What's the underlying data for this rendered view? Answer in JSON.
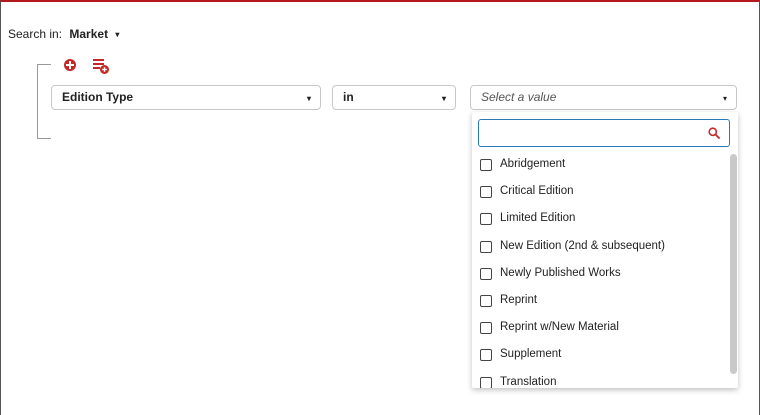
{
  "search_in": {
    "label": "Search in:",
    "scope": "Market",
    "caret": "▾"
  },
  "query_row": {
    "field": {
      "value": "Edition Type",
      "caret": "▾"
    },
    "operator": {
      "value": "in",
      "caret": "▾"
    },
    "value_select": {
      "placeholder": "Select a value",
      "caret": "▾"
    }
  },
  "toolbar_icons": [
    "add-condition-icon",
    "add-group-icon"
  ],
  "dropdown": {
    "search": {
      "value": "",
      "icon": "search-icon"
    },
    "options": [
      {
        "label": "Abridgement",
        "checked": false
      },
      {
        "label": "Critical Edition",
        "checked": false
      },
      {
        "label": "Limited Edition",
        "checked": false
      },
      {
        "label": "New Edition (2nd & subsequent)",
        "checked": false
      },
      {
        "label": "Newly Published Works",
        "checked": false
      },
      {
        "label": "Reprint",
        "checked": false
      },
      {
        "label": "Reprint w/New Material",
        "checked": false
      },
      {
        "label": "Supplement",
        "checked": false
      },
      {
        "label": "Translation",
        "checked": false
      }
    ]
  },
  "colors": {
    "accent": "#c62828",
    "top_border": "#b3191b",
    "focus": "#2a7ab5"
  }
}
